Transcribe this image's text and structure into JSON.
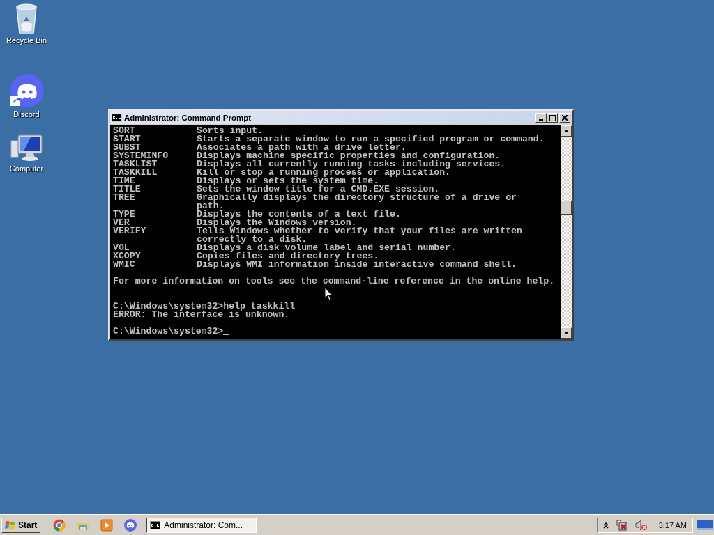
{
  "desktop_icons": [
    {
      "label": "Recycle Bin",
      "kind": "recycle"
    },
    {
      "label": "Discord",
      "kind": "discord"
    },
    {
      "label": "Computer",
      "kind": "computer"
    }
  ],
  "window": {
    "title": "Administrator: Command Prompt",
    "console": [
      {
        "kind": "entry",
        "command": "SORT",
        "description": "Sorts input."
      },
      {
        "kind": "entry",
        "command": "START",
        "description": "Starts a separate window to run a specified program or command."
      },
      {
        "kind": "entry",
        "command": "SUBST",
        "description": "Associates a path with a drive letter."
      },
      {
        "kind": "entry",
        "command": "SYSTEMINFO",
        "description": "Displays machine specific properties and configuration."
      },
      {
        "kind": "entry",
        "command": "TASKLIST",
        "description": "Displays all currently running tasks including services."
      },
      {
        "kind": "entry",
        "command": "TASKKILL",
        "description": "Kill or stop a running process or application."
      },
      {
        "kind": "entry",
        "command": "TIME",
        "description": "Displays or sets the system time."
      },
      {
        "kind": "entry",
        "command": "TITLE",
        "description": "Sets the window title for a CMD.EXE session."
      },
      {
        "kind": "entry",
        "command": "TREE",
        "description": "Graphically displays the directory structure of a drive or"
      },
      {
        "kind": "continuation",
        "text": "path."
      },
      {
        "kind": "entry",
        "command": "TYPE",
        "description": "Displays the contents of a text file."
      },
      {
        "kind": "entry",
        "command": "VER",
        "description": "Displays the Windows version."
      },
      {
        "kind": "entry",
        "command": "VERIFY",
        "description": "Tells Windows whether to verify that your files are written"
      },
      {
        "kind": "continuation",
        "text": "correctly to a disk."
      },
      {
        "kind": "entry",
        "command": "VOL",
        "description": "Displays a disk volume label and serial number."
      },
      {
        "kind": "entry",
        "command": "XCOPY",
        "description": "Copies files and directory trees."
      },
      {
        "kind": "entry",
        "command": "WMIC",
        "description": "Displays WMI information inside interactive command shell."
      },
      {
        "kind": "blank"
      },
      {
        "kind": "text",
        "text": "For more information on tools see the command-line reference in the online help."
      },
      {
        "kind": "blank"
      },
      {
        "kind": "blank"
      },
      {
        "kind": "text",
        "text": "C:\\Windows\\system32>help taskkill"
      },
      {
        "kind": "text",
        "text": "ERROR: The interface is unknown."
      },
      {
        "kind": "blank"
      },
      {
        "kind": "prompt",
        "text": "C:\\Windows\\system32>"
      }
    ]
  },
  "taskbar": {
    "start_label": "Start",
    "pinned": [
      {
        "kind": "chrome"
      },
      {
        "kind": "folder"
      },
      {
        "kind": "media"
      },
      {
        "kind": "discord"
      }
    ],
    "tasks": [
      {
        "label": "Administrator: Com...",
        "selected": true
      }
    ],
    "clock": "3:17 AM"
  }
}
